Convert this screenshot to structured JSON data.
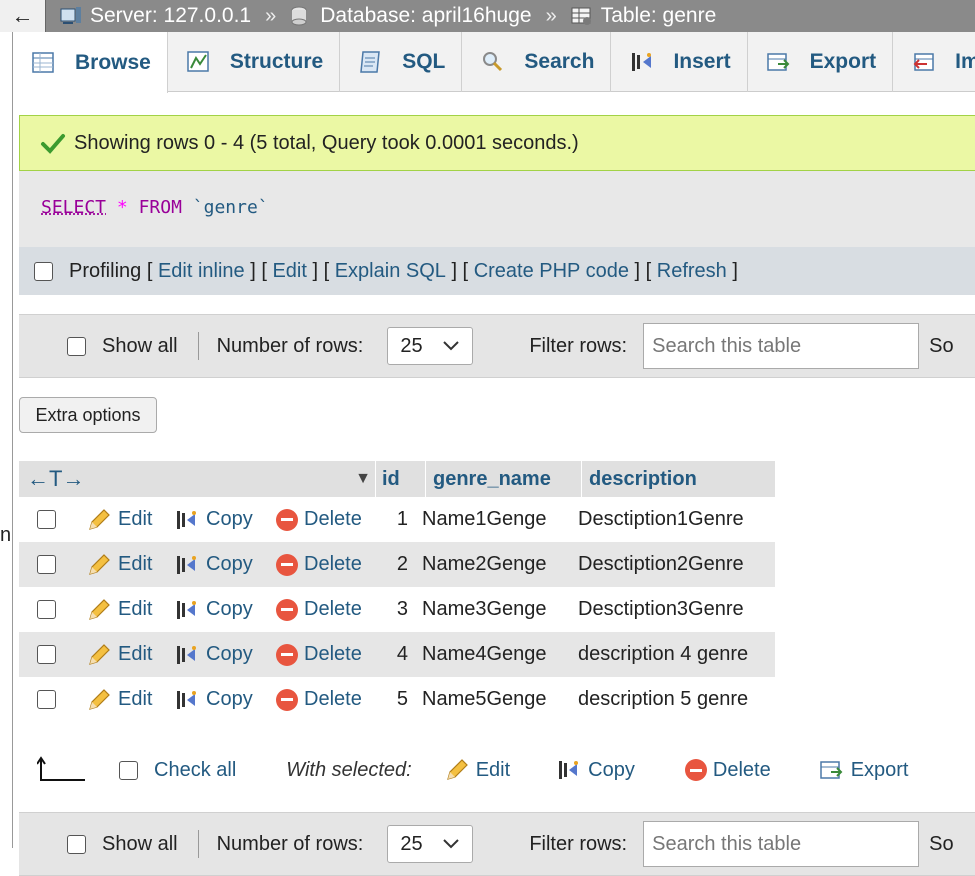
{
  "breadcrumb": {
    "back_glyph": "←",
    "server": "Server: 127.0.0.1",
    "database": "Database: april16huge",
    "table": "Table: genre",
    "separator": "»"
  },
  "tabs": [
    {
      "label": "Browse",
      "icon": "browse-icon",
      "active": true
    },
    {
      "label": "Structure",
      "icon": "structure-icon"
    },
    {
      "label": "SQL",
      "icon": "sql-icon"
    },
    {
      "label": "Search",
      "icon": "search-icon"
    },
    {
      "label": "Insert",
      "icon": "insert-icon"
    },
    {
      "label": "Export",
      "icon": "export-icon"
    },
    {
      "label": "Im",
      "icon": "import-icon"
    }
  ],
  "message": {
    "text": "Showing rows 0 - 4 (5 total, Query took 0.0001 seconds.)"
  },
  "sql": {
    "select": "SELECT",
    "star": "*",
    "from": "FROM",
    "table": "`genre`"
  },
  "profiling": {
    "label": "Profiling",
    "links": [
      "Edit inline",
      "Edit",
      "Explain SQL",
      "Create PHP code",
      "Refresh"
    ]
  },
  "navigation": {
    "show_all": "Show all",
    "rows_label": "Number of rows:",
    "rows_value": "25",
    "filter_label": "Filter rows:",
    "filter_placeholder": "Search this table",
    "sort_label": "So"
  },
  "extra_options": "Extra options",
  "table": {
    "col_arrows": "←T→",
    "columns": [
      "id",
      "genre_name",
      "description"
    ],
    "actions": {
      "edit": "Edit",
      "copy": "Copy",
      "delete": "Delete"
    },
    "rows": [
      {
        "id": "1",
        "genre_name": "Name1Genge",
        "description": "Desctiption1Genre"
      },
      {
        "id": "2",
        "genre_name": "Name2Genge",
        "description": "Desctiption2Genre"
      },
      {
        "id": "3",
        "genre_name": "Name3Genge",
        "description": "Desctiption3Genre"
      },
      {
        "id": "4",
        "genre_name": "Name4Genge",
        "description": "description 4 genre"
      },
      {
        "id": "5",
        "genre_name": "Name5Genge",
        "description": "description 5 genre"
      }
    ]
  },
  "bulk": {
    "check_all": "Check all",
    "with_selected": "With selected:",
    "edit": "Edit",
    "copy": "Copy",
    "delete": "Delete",
    "export": "Export"
  },
  "left_strip_text": "n",
  "colors": {
    "link": "#235a81",
    "success_bg": "#ebf8a4",
    "delete_red": "#e8553f"
  }
}
